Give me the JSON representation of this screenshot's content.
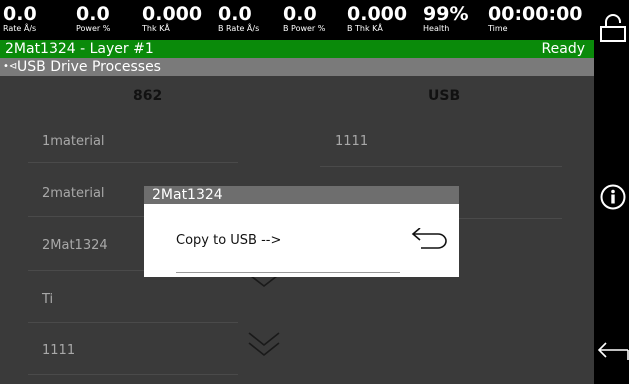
{
  "metrics": [
    {
      "value": "0.0",
      "label": "Rate Å/s"
    },
    {
      "value": "0.0",
      "label": "Power %"
    },
    {
      "value": "0.000",
      "label": "Thk KÅ"
    },
    {
      "value": "0.0",
      "label": "B Rate Å/s"
    },
    {
      "value": "0.0",
      "label": "B Power %"
    },
    {
      "value": "0.000",
      "label": "B Thk KÅ"
    },
    {
      "value": "99%",
      "label": "Health"
    },
    {
      "value": "00:00:00",
      "label": "Time"
    }
  ],
  "status": {
    "title": "2Mat1324 - Layer #1",
    "state": "Ready"
  },
  "path": {
    "icon": "usb-icon",
    "text": "USB Drive Processes"
  },
  "columns": {
    "left": "862",
    "right": "USB"
  },
  "left_list": [
    "1material",
    "2material",
    "2Mat1324",
    "Ti",
    "1111"
  ],
  "right_list": [
    "1111"
  ],
  "dialog": {
    "title": "2Mat1324",
    "action": "Copy to USB -->"
  },
  "colors": {
    "status_green": "#0a8a0a",
    "background": "#3a3a3a",
    "path_grey": "#7a7a7a"
  },
  "icons": {
    "lock": "lock-icon",
    "info": "info-icon",
    "back": "back-arrow-icon",
    "chevron": "chevron-down-icon",
    "return": "return-arrow-icon"
  }
}
